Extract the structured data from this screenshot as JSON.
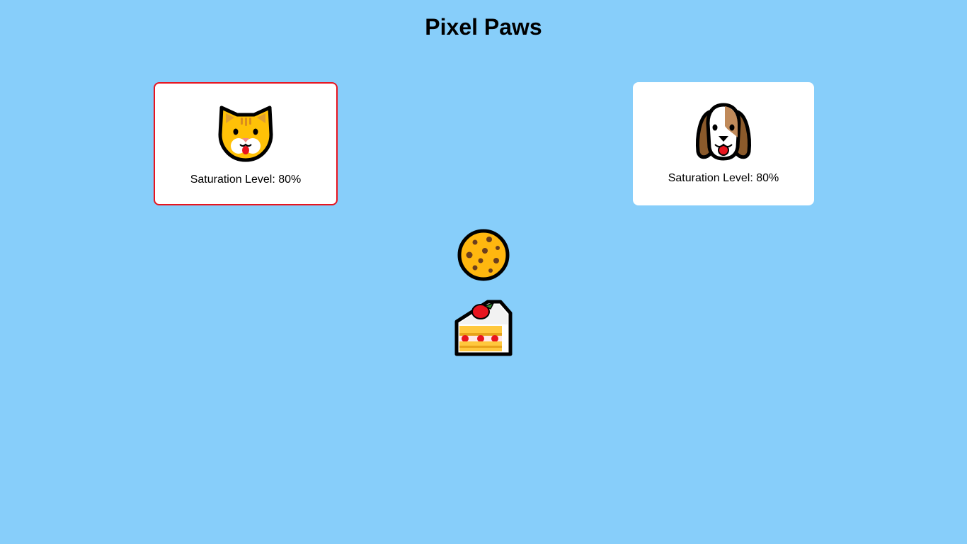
{
  "header": {
    "title": "Pixel Paws"
  },
  "pets": [
    {
      "id": "cat",
      "icon": "cat-face-icon",
      "saturation_label": "Saturation Level: 80%",
      "saturation_level": 80,
      "selected": true
    },
    {
      "id": "dog",
      "icon": "dog-face-icon",
      "saturation_label": "Saturation Level: 80%",
      "saturation_level": 80,
      "selected": false
    }
  ],
  "foods": [
    {
      "id": "cookie",
      "icon": "cookie-icon"
    },
    {
      "id": "cake",
      "icon": "shortcake-icon"
    }
  ],
  "colors": {
    "background": "#87CEFA",
    "card": "#FFFFFF",
    "selected_border": "#E8141E"
  }
}
